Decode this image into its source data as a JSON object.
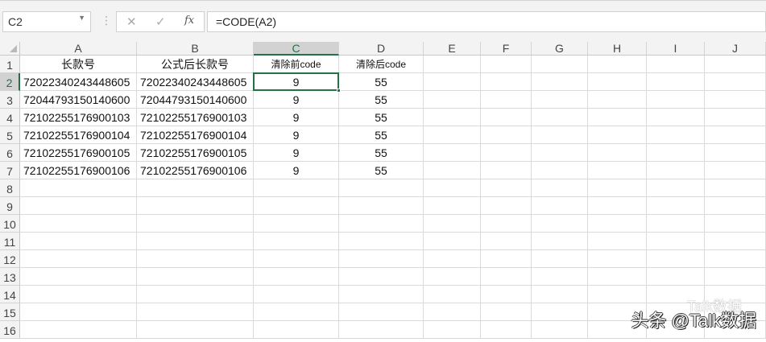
{
  "namebox": {
    "value": "C2"
  },
  "formula_bar": {
    "cancel": "✕",
    "enter": "✓",
    "fx": "fx",
    "value": "=CODE(A2)"
  },
  "columns": [
    "A",
    "B",
    "C",
    "D",
    "E",
    "F",
    "G",
    "H",
    "I",
    "J"
  ],
  "rows": [
    "1",
    "2",
    "3",
    "4",
    "5",
    "6",
    "7",
    "8",
    "9",
    "10",
    "11",
    "12",
    "13",
    "14",
    "15",
    "16"
  ],
  "headers": [
    "长款号",
    "公式后长款号",
    "清除前code",
    "清除后code"
  ],
  "data": [
    [
      "72022340243448605",
      "72022340243448605",
      "9",
      "55"
    ],
    [
      "72044793150140600",
      "72044793150140600",
      "9",
      "55"
    ],
    [
      "72102255176900103",
      "72102255176900103",
      "9",
      "55"
    ],
    [
      "72102255176900104",
      "72102255176900104",
      "9",
      "55"
    ],
    [
      "72102255176900105",
      "72102255176900105",
      "9",
      "55"
    ],
    [
      "72102255176900106",
      "72102255176900106",
      "9",
      "55"
    ]
  ],
  "selected_cell": "C2",
  "watermark": {
    "main": "头条 @Talk数据",
    "secondary": "Talk数据"
  }
}
